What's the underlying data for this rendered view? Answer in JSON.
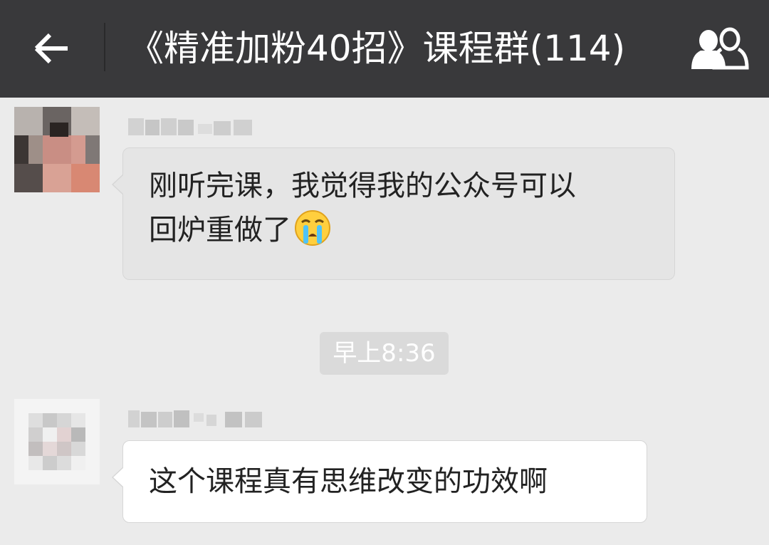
{
  "header": {
    "title": "《精准加粉40招》课程群(114)",
    "back_icon": "arrow-left-icon",
    "group_icon": "group-members-icon",
    "background": "#39393b"
  },
  "chat": {
    "background": "#ebebeb",
    "messages": [
      {
        "text": "刚听完课，我觉得我的公众号可以回炉重做了",
        "line1": "刚听完课，我觉得我的公众号可以",
        "line2": "回炉重做了",
        "emoji": "crying-face-emoji",
        "bubble_color": "#e5e5e5"
      },
      {
        "text": "这个课程真有思维改变的功效啊",
        "bubble_color": "#ffffff"
      }
    ],
    "timestamp": "早上8:36"
  }
}
